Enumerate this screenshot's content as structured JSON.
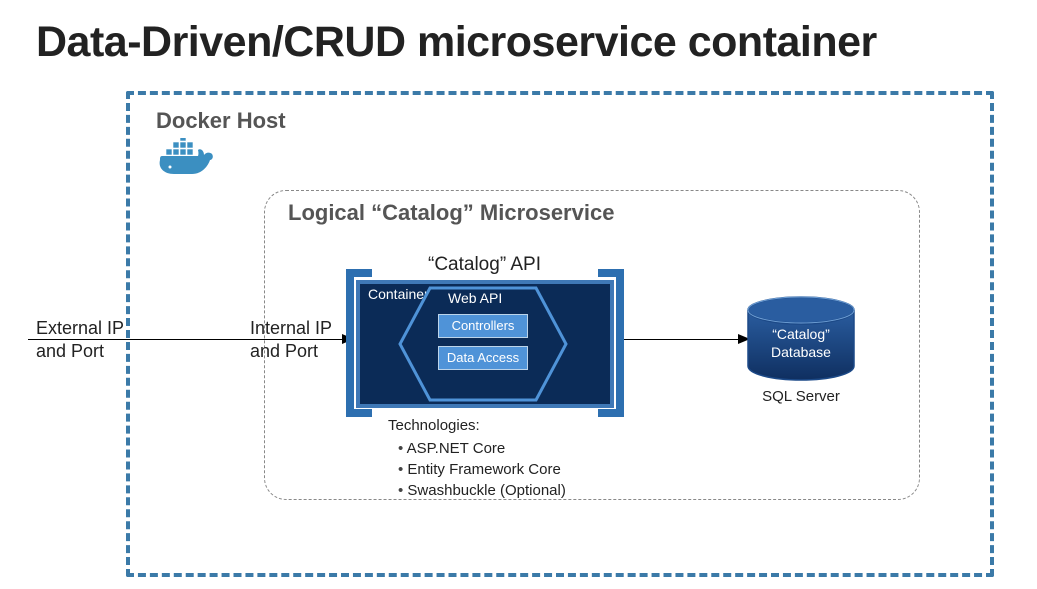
{
  "title": "Data-Driven/CRUD microservice container",
  "docker_host": {
    "label": "Docker Host"
  },
  "logical": {
    "label": "Logical “Catalog” Microservice"
  },
  "labels": {
    "external_line1": "External IP",
    "external_line2": "and Port",
    "internal_line1": "Internal IP",
    "internal_line2": "and Port",
    "catalog_api": "“Catalog” API",
    "container": "Container",
    "webapi": "Web API",
    "controllers": "Controllers",
    "data_access": "Data Access"
  },
  "technologies": {
    "heading": "Technologies:",
    "items": [
      "ASP.NET Core",
      "Entity Framework Core",
      "Swashbuckle (Optional)"
    ]
  },
  "database": {
    "name_line1": "“Catalog”",
    "name_line2": "Database",
    "caption": "SQL Server"
  },
  "icons": {
    "docker": "docker-icon",
    "database": "database-icon"
  },
  "colors": {
    "docker_host_border": "#3b7aa8",
    "container_fill": "#0b2b57",
    "container_border": "#3f78b6",
    "pill": "#4f93d8",
    "db_fill": "#153f7c"
  }
}
